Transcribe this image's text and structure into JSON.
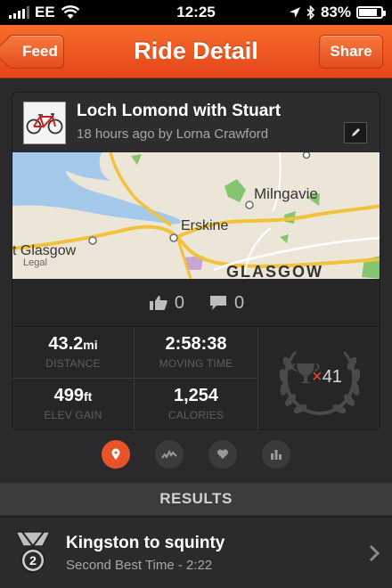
{
  "status_bar": {
    "carrier": "EE",
    "time": "12:25",
    "battery": "83%",
    "battery_level": 0.83
  },
  "nav": {
    "back_label": "Feed",
    "title": "Ride Detail",
    "share_label": "Share"
  },
  "ride": {
    "title": "Loch Lomond with Stuart",
    "subtitle": "18 hours ago by Lorna Crawford"
  },
  "map": {
    "labels": [
      "Milngavie",
      "Erskine",
      "t Glasgow",
      "GLASGOW"
    ],
    "legal": "Legal"
  },
  "social": {
    "kudos_count": "0",
    "comments_count": "0"
  },
  "stats": {
    "distance_value": "43.2",
    "distance_unit": "mi",
    "distance_label": "DISTANCE",
    "moving_time_value": "2:58:38",
    "moving_time_label": "MOVING TIME",
    "elev_value": "499",
    "elev_unit": "ft",
    "elev_label": "ELEV GAIN",
    "calories_value": "1,254",
    "calories_label": "CALORIES",
    "achievements_prefix": "×",
    "achievements_count": "41"
  },
  "tabs": [
    "map-pin-icon",
    "activity-graph-icon",
    "heart-icon",
    "bar-chart-icon"
  ],
  "results": {
    "header": "RESULTS",
    "items": [
      {
        "title": "Kingston to squinty",
        "subtitle": "Second Best Time - 2:22",
        "medal_rank": "2"
      }
    ]
  },
  "colors": {
    "accent": "#e8532a",
    "nav_gradient_top": "#f66d2a",
    "nav_gradient_bottom": "#e5451a",
    "background": "#2a2a2c"
  }
}
